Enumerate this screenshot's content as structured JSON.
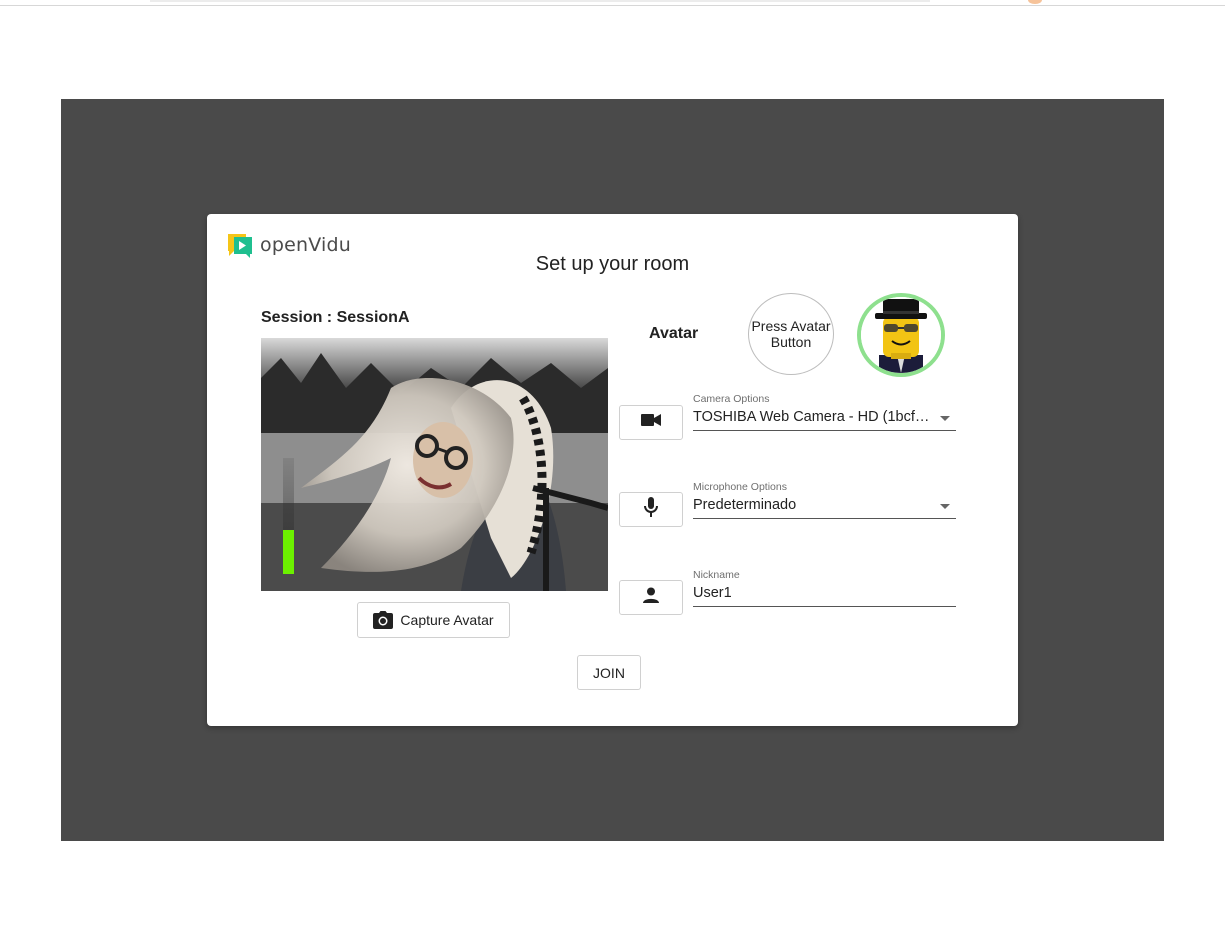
{
  "app": {
    "logo_text": "openVidu"
  },
  "dialog": {
    "title": "Set up your room",
    "session_label": "Session : SessionA",
    "capture_avatar_label": "Capture Avatar",
    "join_label": "JOIN",
    "audio_level": 0.38
  },
  "avatar": {
    "label": "Avatar",
    "press_button_label": "Press Avatar Button"
  },
  "camera": {
    "label": "Camera Options",
    "selected": "TOSHIBA Web Camera - HD (1bcf:2…"
  },
  "microphone": {
    "label": "Microphone Options",
    "selected": "Predeterminado"
  },
  "nickname": {
    "label": "Nickname",
    "value": "User1"
  },
  "colors": {
    "stage_bg": "#4a4a4a",
    "audio_meter": "#6cf000",
    "avatar_ring": "#8ee08e"
  },
  "icons": [
    "openvidu-logo-icon",
    "camera-icon",
    "videocam-icon",
    "mic-icon",
    "person-icon"
  ]
}
